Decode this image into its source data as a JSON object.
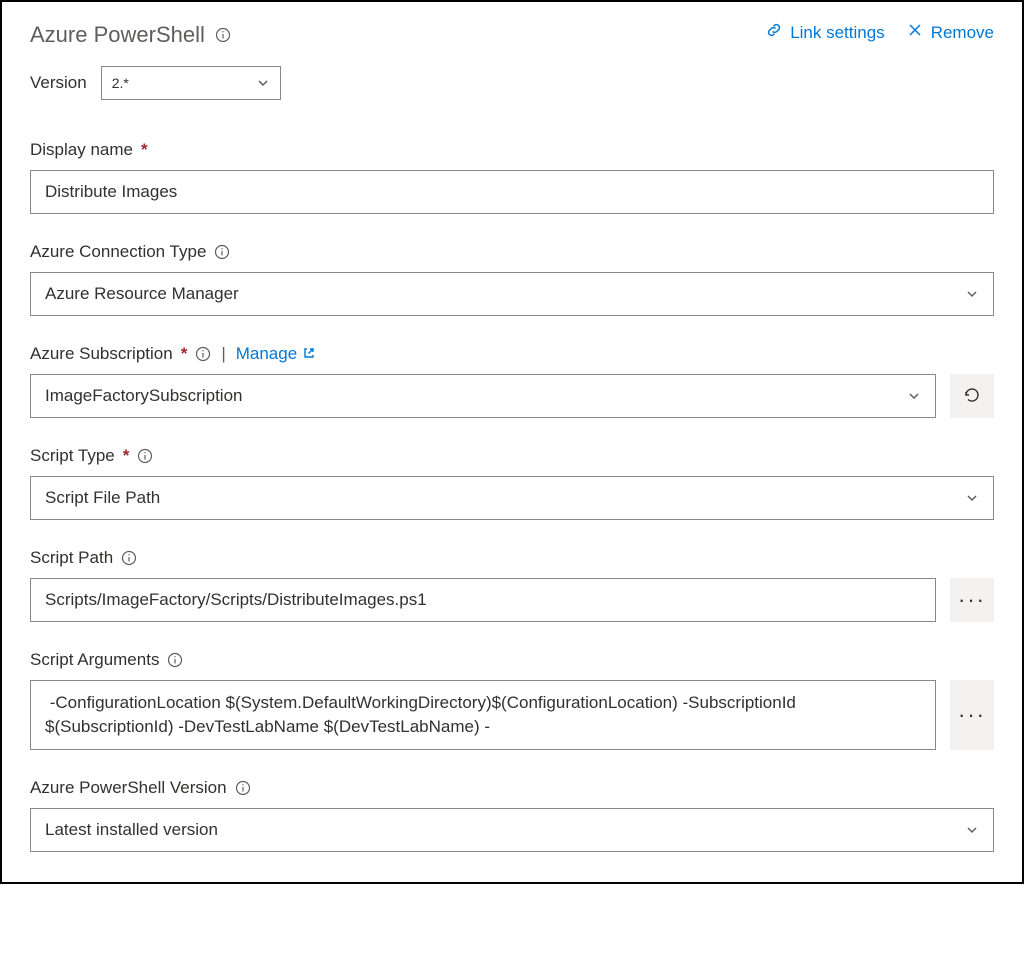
{
  "header": {
    "title": "Azure PowerShell",
    "link_settings": "Link settings",
    "remove": "Remove"
  },
  "version": {
    "label": "Version",
    "value": "2.*"
  },
  "display_name": {
    "label": "Display name",
    "value": "Distribute Images"
  },
  "connection_type": {
    "label": "Azure Connection Type",
    "value": "Azure Resource Manager"
  },
  "subscription": {
    "label": "Azure Subscription",
    "manage": "Manage",
    "value": "ImageFactorySubscription"
  },
  "script_type": {
    "label": "Script Type",
    "value": "Script File Path"
  },
  "script_path": {
    "label": "Script Path",
    "value": "Scripts/ImageFactory/Scripts/DistributeImages.ps1"
  },
  "script_args": {
    "label": "Script Arguments",
    "value": " -ConfigurationLocation $(System.DefaultWorkingDirectory)$(ConfigurationLocation) -SubscriptionId $(SubscriptionId) -DevTestLabName $(DevTestLabName) -"
  },
  "ps_version": {
    "label": "Azure PowerShell Version",
    "value": "Latest installed version"
  }
}
